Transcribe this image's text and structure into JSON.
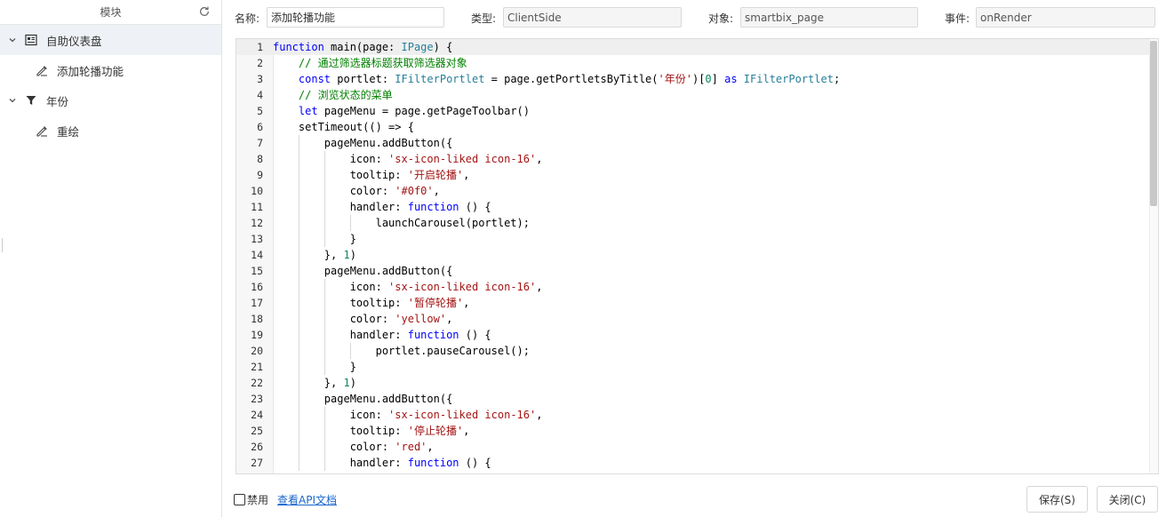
{
  "sidebar": {
    "title": "模块",
    "items": [
      {
        "label": "自助仪表盘",
        "level": 0,
        "icon": "dashboard-icon",
        "expanded": true,
        "selected": true
      },
      {
        "label": "添加轮播功能",
        "level": 1,
        "icon": "script-edit-icon"
      },
      {
        "label": "年份",
        "level": 0,
        "icon": "filter-icon",
        "expanded": true
      },
      {
        "label": "重绘",
        "level": 1,
        "icon": "script-edit-icon"
      }
    ]
  },
  "form": {
    "name_label": "名称:",
    "name_value": "添加轮播功能",
    "type_label": "类型:",
    "type_value": "ClientSide",
    "object_label": "对象:",
    "object_value": "smartbix_page",
    "event_label": "事件:",
    "event_value": "onRender"
  },
  "editor": {
    "current_line": 1,
    "lines": [
      "function main(page: IPage) {",
      "    // 通过筛选器标题获取筛选器对象",
      "    const portlet: IFilterPortlet = page.getPortletsByTitle('年份')[0] as IFilterPortlet;",
      "    // 浏览状态的菜单",
      "    let pageMenu = page.getPageToolbar()",
      "    setTimeout(() => {",
      "        pageMenu.addButton({",
      "            icon: 'sx-icon-liked icon-16',",
      "            tooltip: '开启轮播',",
      "            color: '#0f0',",
      "            handler: function () {",
      "                launchCarousel(portlet);",
      "            }",
      "        }, 1)",
      "        pageMenu.addButton({",
      "            icon: 'sx-icon-liked icon-16',",
      "            tooltip: '暂停轮播',",
      "            color: 'yellow',",
      "            handler: function () {",
      "                portlet.pauseCarousel();",
      "            }",
      "        }, 1)",
      "        pageMenu.addButton({",
      "            icon: 'sx-icon-liked icon-16',",
      "            tooltip: '停止轮播',",
      "            color: 'red',",
      "            handler: function () {"
    ]
  },
  "footer": {
    "disable_label": "禁用",
    "api_link": "查看API文档",
    "save_label": "保存(S)",
    "close_label": "关闭(C)"
  }
}
